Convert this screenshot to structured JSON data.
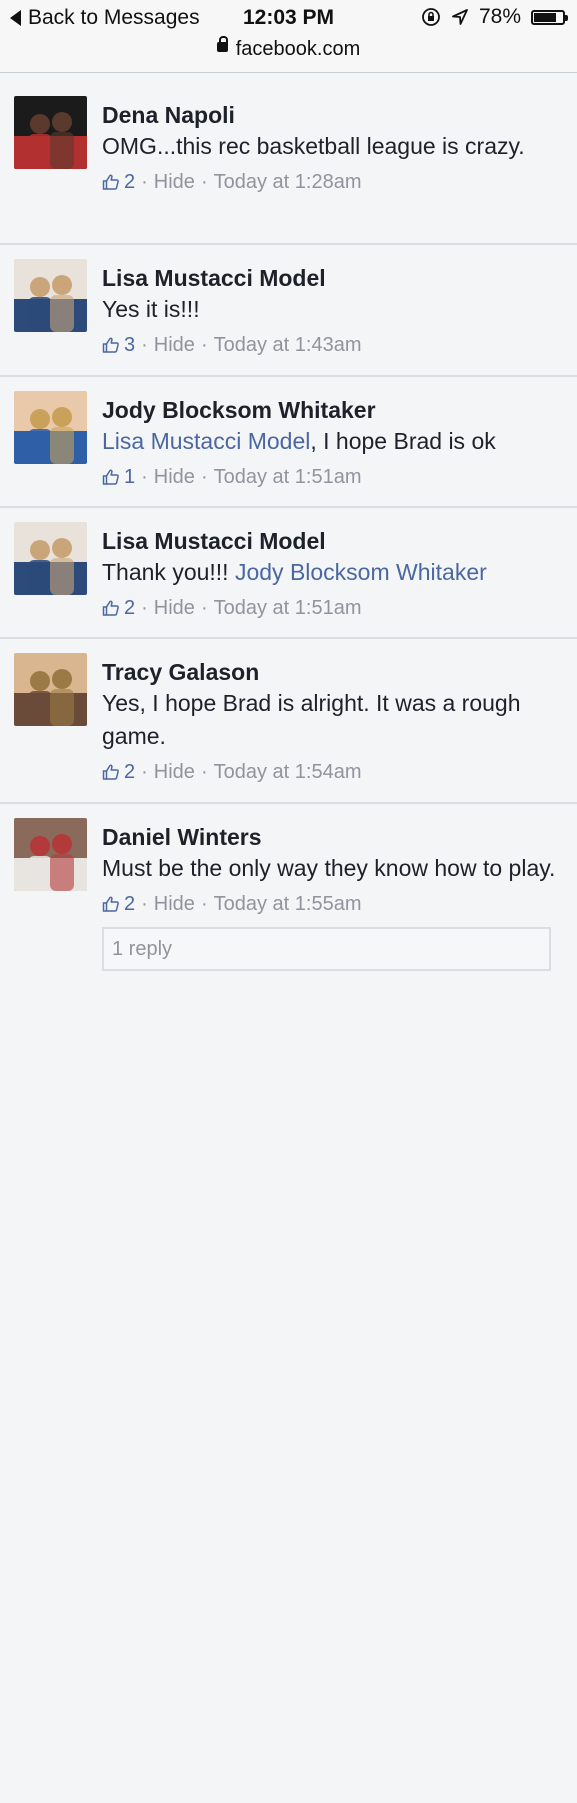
{
  "status_bar": {
    "back_label": "Back to Messages",
    "time": "12:03 PM",
    "battery": "78%",
    "battery_level": 0.78
  },
  "url_bar": {
    "domain": "facebook.com"
  },
  "colors": {
    "mention": "#4b67a1",
    "meta": "#90949c",
    "text": "#1d2129"
  },
  "comments": [
    {
      "name": "Dena Napoli",
      "text_parts": [
        {
          "t": "OMG...this rec basketball league is crazy.",
          "m": false
        }
      ],
      "likes": "2",
      "hide": "Hide",
      "timestamp": "Today at 1:28am"
    },
    {
      "name": "Lisa Mustacci Model",
      "text_parts": [
        {
          "t": "Yes it is!!!",
          "m": false
        }
      ],
      "likes": "3",
      "hide": "Hide",
      "timestamp": "Today at 1:43am"
    },
    {
      "name": "Jody Blocksom Whitaker",
      "text_parts": [
        {
          "t": "Lisa Mustacci Model",
          "m": true
        },
        {
          "t": ", I hope Brad is ok",
          "m": false
        }
      ],
      "likes": "1",
      "hide": "Hide",
      "timestamp": "Today at 1:51am"
    },
    {
      "name": "Lisa Mustacci Model",
      "text_parts": [
        {
          "t": "Thank you!!! ",
          "m": false
        },
        {
          "t": "Jody Blocksom Whitaker",
          "m": true
        }
      ],
      "likes": "2",
      "hide": "Hide",
      "timestamp": "Today at 1:51am"
    },
    {
      "name": "Tracy Galason",
      "text_parts": [
        {
          "t": "Yes, I hope Brad is alright. It was a rough game.",
          "m": false
        }
      ],
      "likes": "2",
      "hide": "Hide",
      "timestamp": "Today at 1:54am"
    },
    {
      "name": "Daniel Winters",
      "text_parts": [
        {
          "t": "Must be the only way they know how to play.",
          "m": false
        }
      ],
      "likes": "2",
      "hide": "Hide",
      "timestamp": "Today at 1:55am",
      "reply_label": "1 reply"
    }
  ]
}
